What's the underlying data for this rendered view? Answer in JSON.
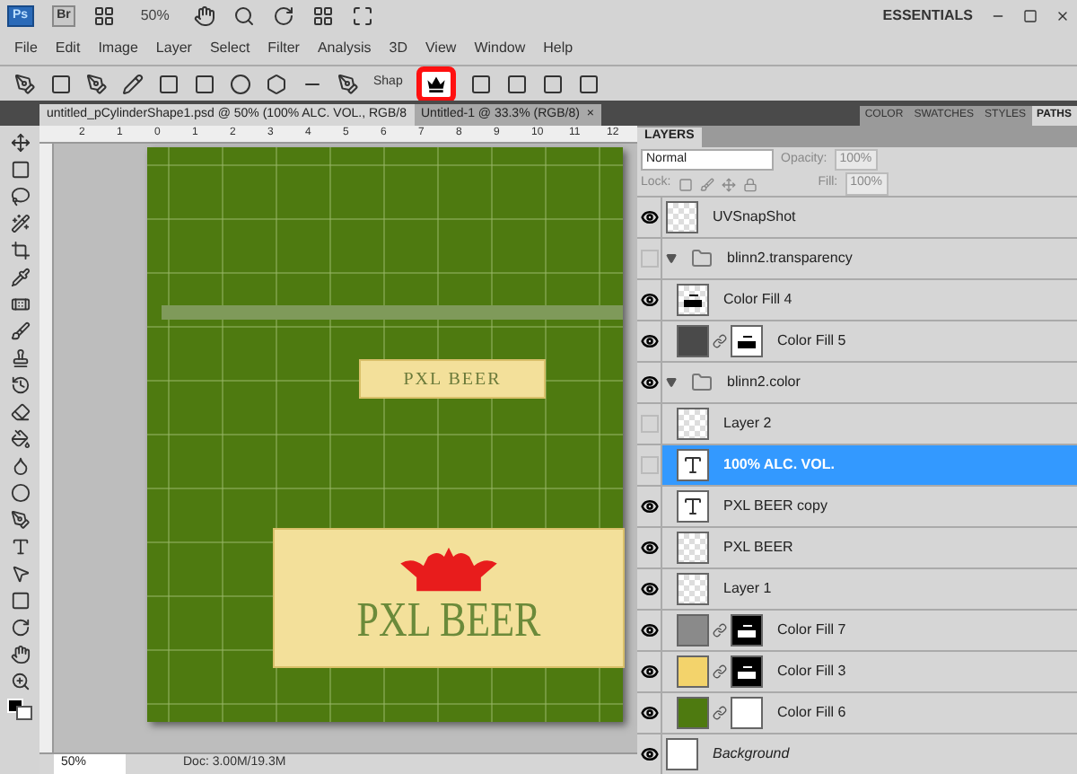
{
  "app_bar": {
    "logo": "Ps",
    "bridge": "Br",
    "zoom": "50%",
    "workspace": "ESSENTIALS"
  },
  "menu": [
    "File",
    "Edit",
    "Image",
    "Layer",
    "Select",
    "Filter",
    "Analysis",
    "3D",
    "View",
    "Window",
    "Help"
  ],
  "options_bar": {
    "shape_label": "Shap",
    "highlighted": true
  },
  "doc_tabs": [
    {
      "label": "untitled_pCylinderShape1.psd @ 50% (100% ALC. VOL., RGB/8",
      "selected": true
    },
    {
      "label": "Untitled-1 @ 33.3% (RGB/8)",
      "selected": false,
      "close": "×"
    }
  ],
  "panel_tabs": [
    {
      "label": "COLOR",
      "selected": false
    },
    {
      "label": "SWATCHES",
      "selected": false
    },
    {
      "label": "STYLES",
      "selected": false
    },
    {
      "label": "PATHS",
      "selected": true
    }
  ],
  "ruler": [
    "2",
    "1",
    "0",
    "1",
    "2",
    "3",
    "4",
    "5",
    "6",
    "7",
    "8",
    "9",
    "10",
    "11",
    "12"
  ],
  "canvas": {
    "small_label": "PXL BEER",
    "big_label": "PXL BEER"
  },
  "status_bar": {
    "zoom": "50%",
    "doc": "Doc: 3.00M/19.3M"
  },
  "layers_panel": {
    "title": "LAYERS",
    "blend_mode": "Normal",
    "opacity_label": "Opacity:",
    "opacity": "100%",
    "lock_label": "Lock:",
    "fill_label": "Fill:",
    "fill": "100%",
    "layers": [
      {
        "kind": "layer",
        "name": "UVSnapShot",
        "visible": true,
        "thumb": {
          "kind": "pixel"
        },
        "selected": false
      },
      {
        "kind": "group",
        "name": "blinn2.transparency",
        "visible": false,
        "expanded": true,
        "selected": false,
        "children": [
          {
            "kind": "layer",
            "name": "Color Fill 4",
            "visible": true,
            "thumb": {
              "kind": "shape"
            },
            "selected": false
          },
          {
            "kind": "layer",
            "name": "Color Fill 5",
            "visible": true,
            "thumb": {
              "kind": "fill"
            },
            "color": "#4a4a4a",
            "mask": {
              "kind": "white-shape"
            },
            "selected": false
          }
        ]
      },
      {
        "kind": "group",
        "name": "blinn2.color",
        "visible": true,
        "expanded": true,
        "selected": false,
        "children": [
          {
            "kind": "layer",
            "name": "Layer 2",
            "visible": false,
            "thumb": {
              "kind": "pixel"
            },
            "selected": false
          },
          {
            "kind": "layer",
            "name": "100% ALC. VOL.",
            "visible": false,
            "thumb": {
              "kind": "text"
            },
            "selected": true
          },
          {
            "kind": "layer",
            "name": "PXL BEER copy",
            "visible": true,
            "thumb": {
              "kind": "text"
            },
            "selected": false
          },
          {
            "kind": "layer",
            "name": "PXL BEER",
            "visible": true,
            "thumb": {
              "kind": "pixel"
            },
            "selected": false
          },
          {
            "kind": "layer",
            "name": "Layer 1",
            "visible": true,
            "thumb": {
              "kind": "pixel"
            },
            "selected": false
          },
          {
            "kind": "layer",
            "name": "Color Fill 7",
            "visible": true,
            "thumb": {
              "kind": "fill"
            },
            "color": "#8a8a8a",
            "mask": {
              "kind": "black-shape"
            },
            "selected": false
          },
          {
            "kind": "layer",
            "name": "Color Fill 3",
            "visible": true,
            "thumb": {
              "kind": "fill"
            },
            "color": "#f3d36b",
            "mask": {
              "kind": "black-shape"
            },
            "selected": false
          },
          {
            "kind": "layer",
            "name": "Color Fill 6",
            "visible": true,
            "thumb": {
              "kind": "fill"
            },
            "color": "#4e7a10",
            "mask": {
              "kind": "white"
            },
            "selected": false
          }
        ]
      },
      {
        "kind": "background",
        "name": "Background",
        "visible": true,
        "thumb": {
          "kind": "white"
        },
        "selected": false
      }
    ]
  }
}
